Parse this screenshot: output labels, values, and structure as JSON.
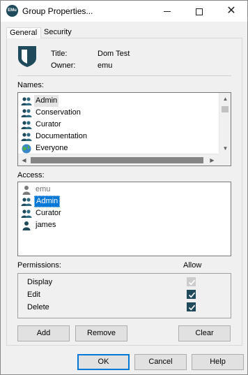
{
  "window": {
    "app_icon_text": "EMu",
    "title": "Group Properties...",
    "close_glyph": "✕"
  },
  "tabs": [
    {
      "label": "General"
    },
    {
      "label": "Security"
    }
  ],
  "header": {
    "title_label": "Title:",
    "title_value": "Dom Test",
    "owner_label": "Owner:",
    "owner_value": "emu",
    "icon": "shield-icon",
    "icon_color": "#1e4a5c"
  },
  "names": {
    "label": "Names:",
    "items": [
      {
        "label": "Admin",
        "icon": "group-icon",
        "state": "hover"
      },
      {
        "label": "Conservation",
        "icon": "group-icon"
      },
      {
        "label": "Curator",
        "icon": "group-icon"
      },
      {
        "label": "Documentation",
        "icon": "group-icon"
      },
      {
        "label": "Everyone",
        "icon": "globe-icon"
      }
    ]
  },
  "access": {
    "label": "Access:",
    "items": [
      {
        "label": "emu",
        "icon": "user-icon",
        "state": "disabled"
      },
      {
        "label": "Admin",
        "icon": "group-icon",
        "state": "selected"
      },
      {
        "label": "Curator",
        "icon": "group-icon"
      },
      {
        "label": "james",
        "icon": "user-icon"
      }
    ]
  },
  "permissions": {
    "label": "Permissions:",
    "allow_label": "Allow",
    "rows": [
      {
        "label": "Display",
        "checked": true,
        "enabled": false
      },
      {
        "label": "Edit",
        "checked": true,
        "enabled": true
      },
      {
        "label": "Delete",
        "checked": true,
        "enabled": true
      }
    ]
  },
  "buttons": {
    "add": "Add",
    "remove": "Remove",
    "clear": "Clear",
    "ok": "OK",
    "cancel": "Cancel",
    "help": "Help"
  },
  "colors": {
    "selection": "#0078d7",
    "accent": "#1e4a5c"
  }
}
